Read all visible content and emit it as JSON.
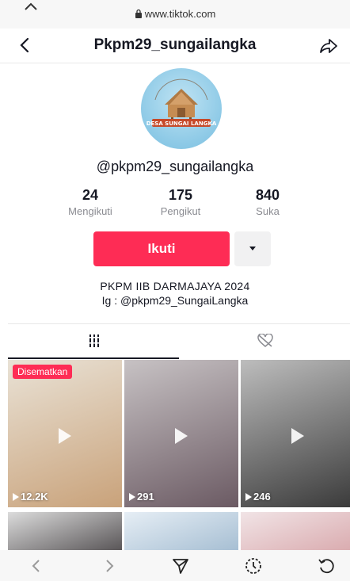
{
  "browser": {
    "url": "www.tiktok.com"
  },
  "header": {
    "title": "Pkpm29_sungailangka"
  },
  "avatar": {
    "alt_text_shown": "DESA SUNGAI LANGKA"
  },
  "profile": {
    "handle": "@pkpm29_sungailangka",
    "stats": [
      {
        "value": "24",
        "label": "Mengikuti"
      },
      {
        "value": "175",
        "label": "Pengikut"
      },
      {
        "value": "840",
        "label": "Suka"
      }
    ],
    "follow_label": "Ikuti",
    "bio_line1": "PKPM IIB DARMAJAYA 2024",
    "bio_line2": "Ig : @pkpm29_SungaiLangka"
  },
  "videos": [
    {
      "badge": "Disematkan",
      "views": "12.2K",
      "colors": [
        "#c9a27a",
        "#e9e2d6"
      ]
    },
    {
      "badge": "",
      "views": "291",
      "colors": [
        "#6b5a63",
        "#c7c2c4"
      ]
    },
    {
      "badge": "",
      "views": "246",
      "colors": [
        "#3a3a3a",
        "#bdbdbd"
      ]
    },
    {
      "badge": "",
      "views": "",
      "colors": [
        "#4a4648",
        "#dcdcdc"
      ]
    },
    {
      "badge": "",
      "views": "",
      "colors": [
        "#9fb9cf",
        "#e6eef5"
      ]
    },
    {
      "badge": "",
      "views": "",
      "colors": [
        "#d7a4a8",
        "#f1e4e6"
      ]
    }
  ],
  "colors": {
    "accent": "#fe2c55",
    "text": "#161823",
    "muted": "#8a8b91"
  }
}
